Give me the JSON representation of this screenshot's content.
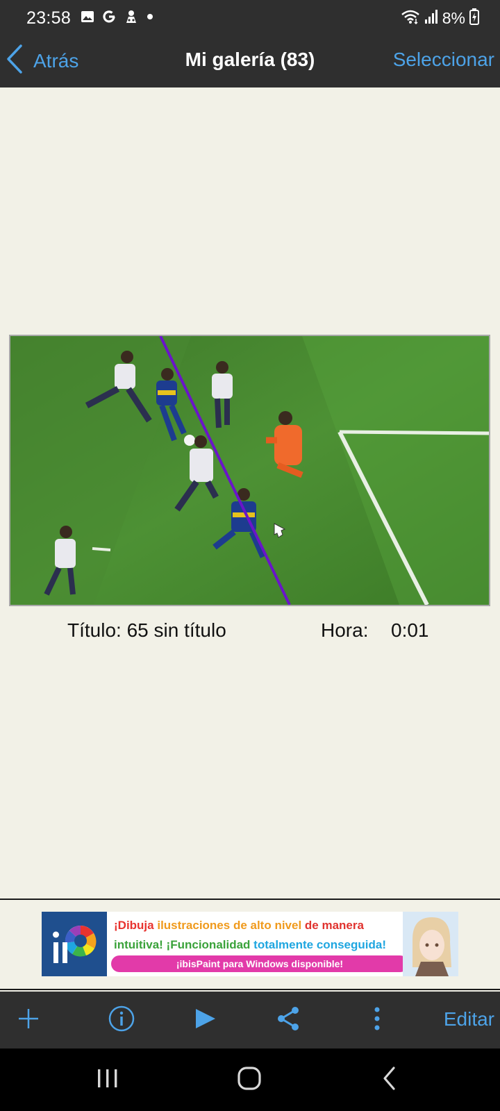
{
  "status_bar": {
    "time": "23:58",
    "left_icons": [
      "gallery-icon",
      "google-icon",
      "incognito-icon",
      "dot-icon"
    ],
    "right_icons": [
      "wifi-icon",
      "signal-icon",
      "battery-charging-icon"
    ],
    "battery": "8%"
  },
  "nav": {
    "back_label": "Atrás",
    "title": "Mi galería (83)",
    "select_label": "Seleccionar"
  },
  "artwork": {
    "description_icon": "soccer-offside-image"
  },
  "info": {
    "title_label": "Título: 65 sin título",
    "hora_label": "Hora:",
    "hora_value": "0:01"
  },
  "ad": {
    "line1_a": "¡Dibuja ",
    "line1_b": "ilustraciones de alto nivel",
    "line1_c": " de manera",
    "line2_a": "intuitiva! ¡Funcionalidad ",
    "line2_b": "totalmente conseguida!",
    "pill": "¡ibisPaint para Windows disponible!"
  },
  "toolbar": {
    "icons": [
      "plus-icon",
      "info-icon",
      "play-icon",
      "share-icon",
      "more-vertical-icon"
    ],
    "edit_label": "Editar"
  },
  "system_nav": [
    "recents-icon",
    "home-icon",
    "back-icon"
  ],
  "colors": {
    "accent": "#4da3e8",
    "bar": "#2f2f2f",
    "background": "#f2f1e7"
  }
}
